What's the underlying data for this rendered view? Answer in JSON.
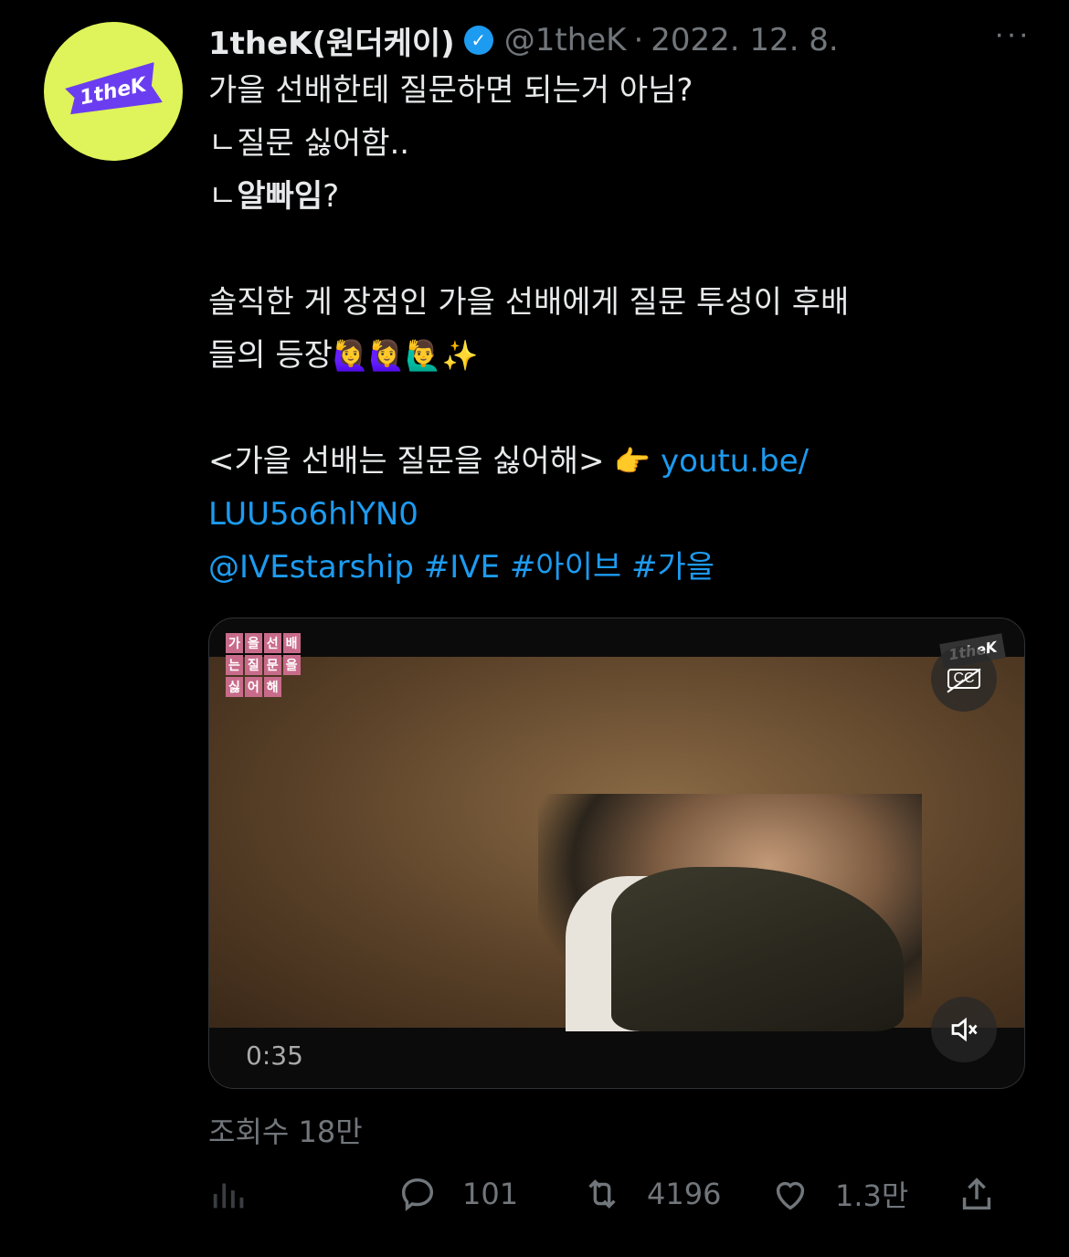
{
  "author": {
    "display_name": "1theK(원더케이)",
    "handle": "@1theK",
    "separator": "·",
    "date": "2022. 12. 8.",
    "avatar_text": "1theK",
    "more": "···"
  },
  "tweet": {
    "line1": "가을 선배한테 질문하면 되는거 아님?",
    "line2": "ㄴ질문 싫어함..",
    "line3_prefix": "ㄴ",
    "line3_bold": "알빠임",
    "line3_suffix": "?",
    "line4": "솔직한 게 장점인 가을 선배에게 질문 투성이 후배",
    "line5_text": "들의 등장",
    "line5_emoji": "🙋‍♀️🙋‍♀️🙋‍♂️✨",
    "line6_text": "<가을 선배는 질문을 싫어해> ",
    "line6_emoji": "👉",
    "link1": "youtu.be/",
    "link2": "LUU5o6hlYN0",
    "mention": "@IVEstarship",
    "hashtags": [
      "#IVE",
      "#아이브",
      "#가을"
    ]
  },
  "media": {
    "timestamp": "0:35",
    "brand": "1theK",
    "cc_label": "CC",
    "overlay_chars": [
      "가",
      "을",
      "선",
      "배",
      "는",
      "질",
      "문",
      "을",
      "싫",
      "어",
      "해"
    ]
  },
  "stats": {
    "views": "조회수 18만",
    "replies": "101",
    "retweets": "4196",
    "likes": "1.3만"
  }
}
